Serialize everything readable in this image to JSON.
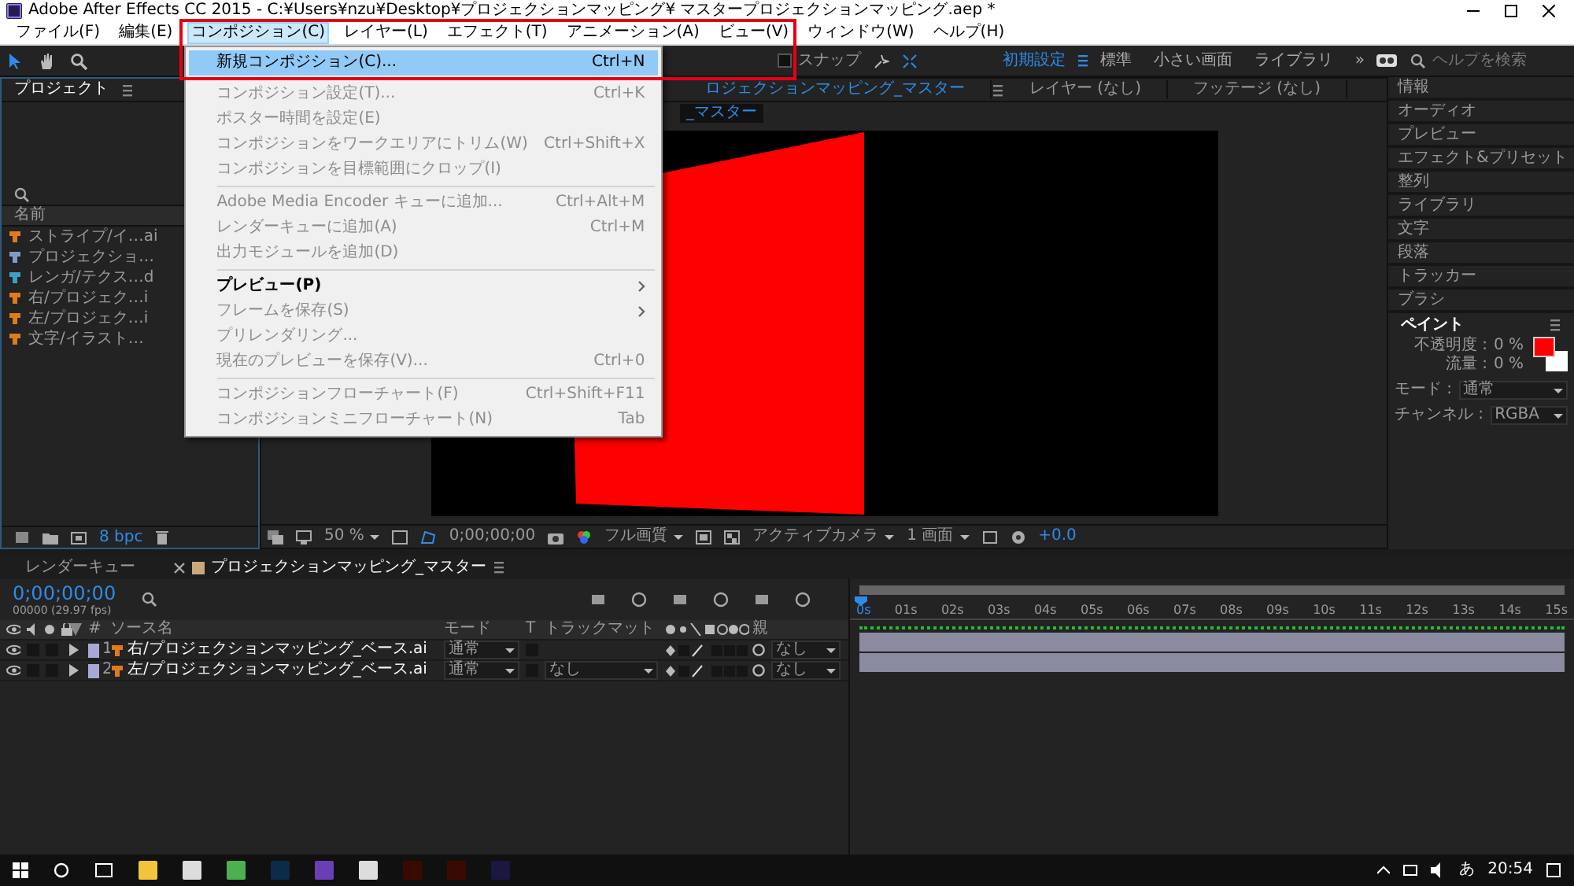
{
  "window": {
    "title": "Adobe After Effects CC 2015 - C:¥Users¥nzu¥Desktop¥プロジェクションマッピング¥ マスタープロジェクションマッピング.aep *"
  },
  "menu_bar": [
    {
      "label": "ファイル(F)",
      "selected": false
    },
    {
      "label": "編集(E)",
      "selected": false
    },
    {
      "label": "コンポジション(C)",
      "selected": true
    },
    {
      "label": "レイヤー(L)",
      "selected": false
    },
    {
      "label": "エフェクト(T)",
      "selected": false
    },
    {
      "label": "アニメーション(A)",
      "selected": false
    },
    {
      "label": "ビュー(V)",
      "selected": false
    },
    {
      "label": "ウィンドウ(W)",
      "selected": false
    },
    {
      "label": "ヘルプ(H)",
      "selected": false
    }
  ],
  "composition_menu": {
    "groups": [
      [
        {
          "label": "新規コンポジション(C)...",
          "shortcut": "Ctrl+N",
          "disabled": false,
          "selected": true,
          "submenu": false
        },
        {
          "label": "コンポジション設定(T)...",
          "shortcut": "Ctrl+K",
          "disabled": true,
          "selected": false,
          "submenu": false
        },
        {
          "label": "ポスター時間を設定(E)",
          "disabled": true,
          "selected": false,
          "submenu": false
        },
        {
          "label": "コンポジションをワークエリアにトリム(W)",
          "shortcut": "Ctrl+Shift+X",
          "disabled": true,
          "selected": false,
          "submenu": false
        },
        {
          "label": "コンポジションを目標範囲にクロップ(I)",
          "disabled": true,
          "selected": false,
          "submenu": false
        }
      ],
      [
        {
          "label": "Adobe Media Encoder キューに追加...",
          "shortcut": "Ctrl+Alt+M",
          "disabled": true,
          "selected": false,
          "submenu": false
        },
        {
          "label": "レンダーキューに追加(A)",
          "shortcut": "Ctrl+M",
          "disabled": true,
          "selected": false,
          "submenu": false
        },
        {
          "label": "出力モジュールを追加(D)",
          "disabled": true,
          "selected": false,
          "submenu": false
        }
      ],
      [
        {
          "label": "プレビュー(P)",
          "disabled": false,
          "selected": false,
          "submenu": true
        },
        {
          "label": "フレームを保存(S)",
          "disabled": true,
          "selected": false,
          "submenu": true
        },
        {
          "label": "プリレンダリング...",
          "disabled": true,
          "selected": false,
          "submenu": false
        },
        {
          "label": "現在のプレビューを保存(V)...",
          "shortcut": "Ctrl+0",
          "disabled": true,
          "selected": false,
          "submenu": false
        }
      ],
      [
        {
          "label": "コンポジションフローチャート(F)",
          "shortcut": "Ctrl+Shift+F11",
          "disabled": true,
          "selected": false,
          "submenu": false
        },
        {
          "label": "コンポジションミニフローチャート(N)",
          "shortcut": "Tab",
          "disabled": true,
          "selected": false,
          "submenu": false
        }
      ]
    ]
  },
  "toolbar": {
    "tools": [
      {
        "kind": "selection",
        "selected": true
      },
      {
        "kind": "hand",
        "selected": false
      },
      {
        "kind": "zoom",
        "selected": false
      }
    ],
    "snap": {
      "label": "スナップ",
      "checked": false
    },
    "workspaces": [
      {
        "label": "初期設定",
        "selected": true
      },
      {
        "label": "標準",
        "selected": false
      },
      {
        "label": "小さい画面",
        "selected": false
      },
      {
        "label": "ライブラリ",
        "selected": false
      }
    ],
    "overflow": "»",
    "help_search": {
      "placeholder": "ヘルプを検索"
    }
  },
  "project_panel": {
    "title": "プロジェクト",
    "column": "名前",
    "items": [
      {
        "name": "ストライプ/イ…ai",
        "kind": "footage"
      },
      {
        "name": "プロジェクショ…",
        "kind": "comp"
      },
      {
        "name": "レンガ/テクス…d",
        "kind": "image"
      },
      {
        "name": "右/プロジェク…i",
        "kind": "footage"
      },
      {
        "name": "左/プロジェク…i",
        "kind": "footage"
      },
      {
        "name": "文字/イラスト…",
        "kind": "footage"
      }
    ],
    "bit_depth": "8 bpc"
  },
  "viewer": {
    "tabs": [
      {
        "label": "ロジェクションマッピング_マスター",
        "selected": true
      },
      {
        "label": "レイヤー (なし)",
        "selected": false
      },
      {
        "label": "フッテージ (なし)",
        "selected": false
      }
    ],
    "breadcrumb": "_マスター",
    "zoom": "50 %",
    "timecode": "0;00;00;00",
    "resolution": "フル画質",
    "camera": "アクティブカメラ",
    "views": "1 画面",
    "exposure": "+0.0"
  },
  "right_panel": {
    "panels": [
      "情報",
      "オーディオ",
      "プレビュー",
      "エフェクト&プリセット",
      "整列",
      "ライブラリ",
      "文字",
      "段落",
      "トラッカー",
      "ブラシ"
    ],
    "paint": {
      "title": "ペイント",
      "opacity_label": "不透明度 :",
      "opacity": "0 %",
      "flow_label": "流量 :",
      "flow": "0 %",
      "mode_label": "モード :",
      "mode": "通常",
      "channel_label": "チャンネル :",
      "channel": "RGBA"
    }
  },
  "timeline": {
    "tabs": [
      {
        "label": "レンダーキュー",
        "selected": false
      },
      {
        "label": "プロジェクションマッピング_マスター",
        "selected": true
      }
    ],
    "timecode": "0;00;00;00",
    "fps": "00000 (29.97 fps)",
    "columns": {
      "number": "#",
      "source": "ソース名",
      "mode": "モード",
      "t": "T",
      "trackmatte": "トラックマット",
      "parent": "親"
    },
    "layers": [
      {
        "number": "1",
        "name": "右/プロジェクションマッピング_ベース.ai",
        "mode": "通常",
        "parent": "なし"
      },
      {
        "number": "2",
        "name": "左/プロジェクションマッピング_ベース.ai",
        "mode": "通常",
        "trackmatte": "なし",
        "parent": "なし"
      }
    ],
    "ruler": [
      "0s",
      "01s",
      "02s",
      "03s",
      "04s",
      "05s",
      "06s",
      "07s",
      "08s",
      "09s",
      "10s",
      "11s",
      "12s",
      "13s",
      "14s",
      "15s"
    ]
  },
  "taskbar": {
    "ime": "あ",
    "clock": "20:54"
  }
}
